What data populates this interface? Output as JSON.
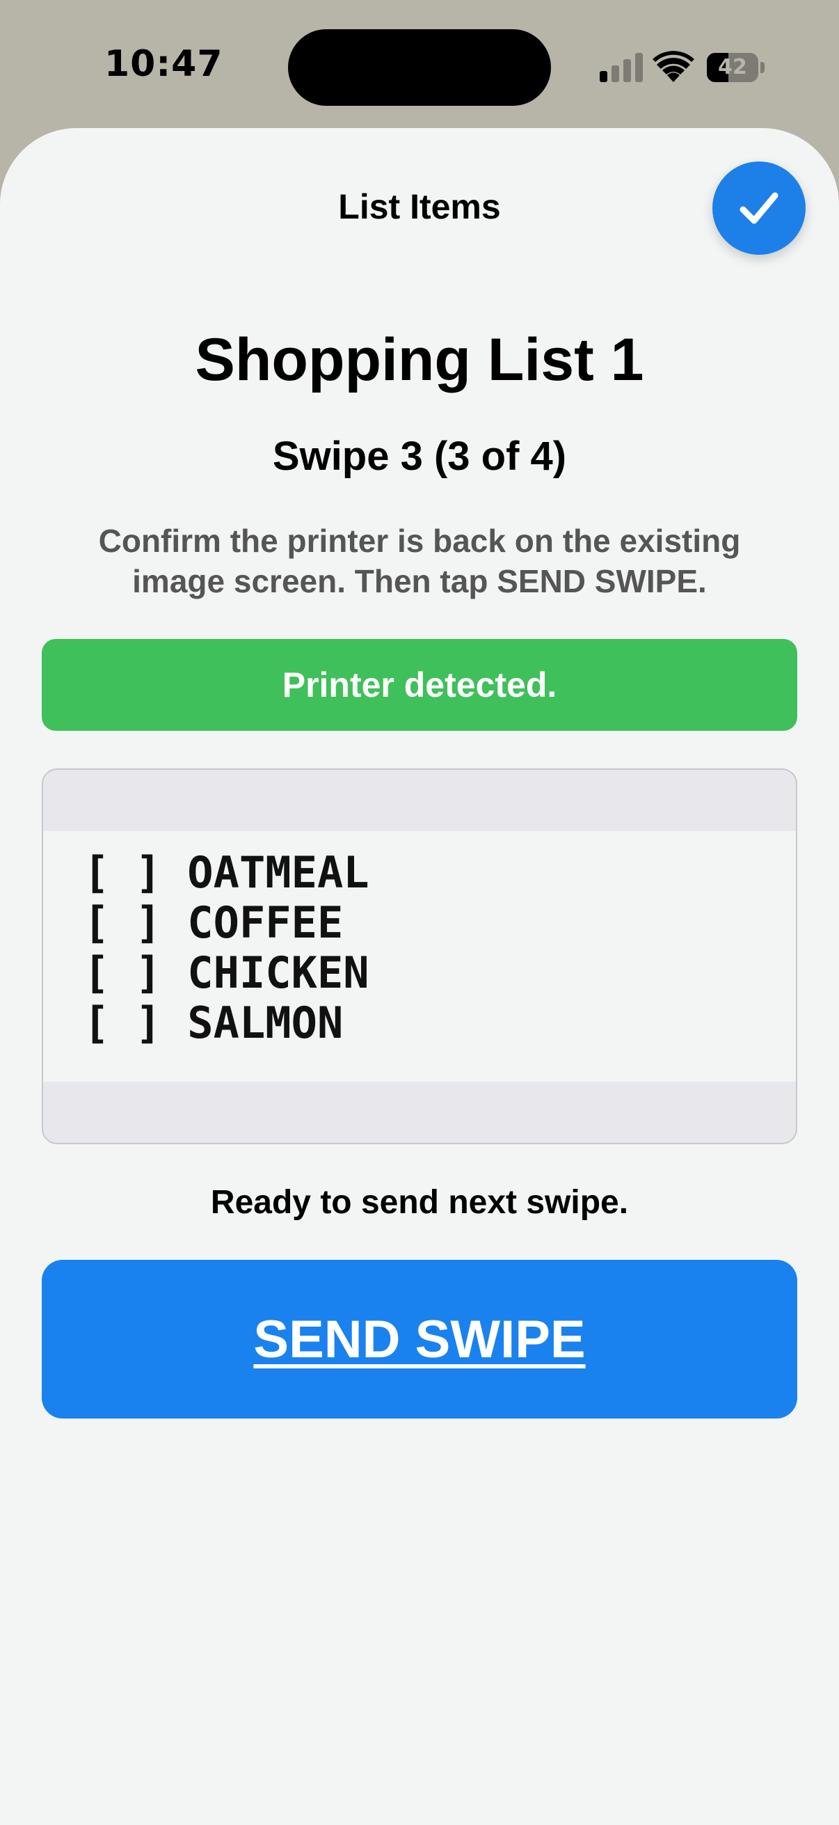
{
  "status_bar": {
    "time": "10:47",
    "battery_level": "42",
    "battery_fraction": 0.42
  },
  "sheet": {
    "title": "List Items",
    "done_icon": "checkmark-icon"
  },
  "main": {
    "list_name": "Shopping List 1",
    "swipe_label": "Swipe 3 (3 of 4)",
    "instructions": "Confirm the printer is back on the existing image screen. Then tap SEND SWIPE.",
    "status_banner": "Printer detected.",
    "preview_items": [
      "[ ] OATMEAL",
      "[ ] COFFEE",
      "[ ] CHICKEN",
      "[ ] SALMON"
    ],
    "ready_text": "Ready to send next swipe.",
    "send_button_label": "SEND SWIPE"
  },
  "colors": {
    "accent_blue": "#1a82ee",
    "success_green": "#3fc05a",
    "sheet_background": "#f3f5f5",
    "screen_background": "#b7b4a8"
  }
}
